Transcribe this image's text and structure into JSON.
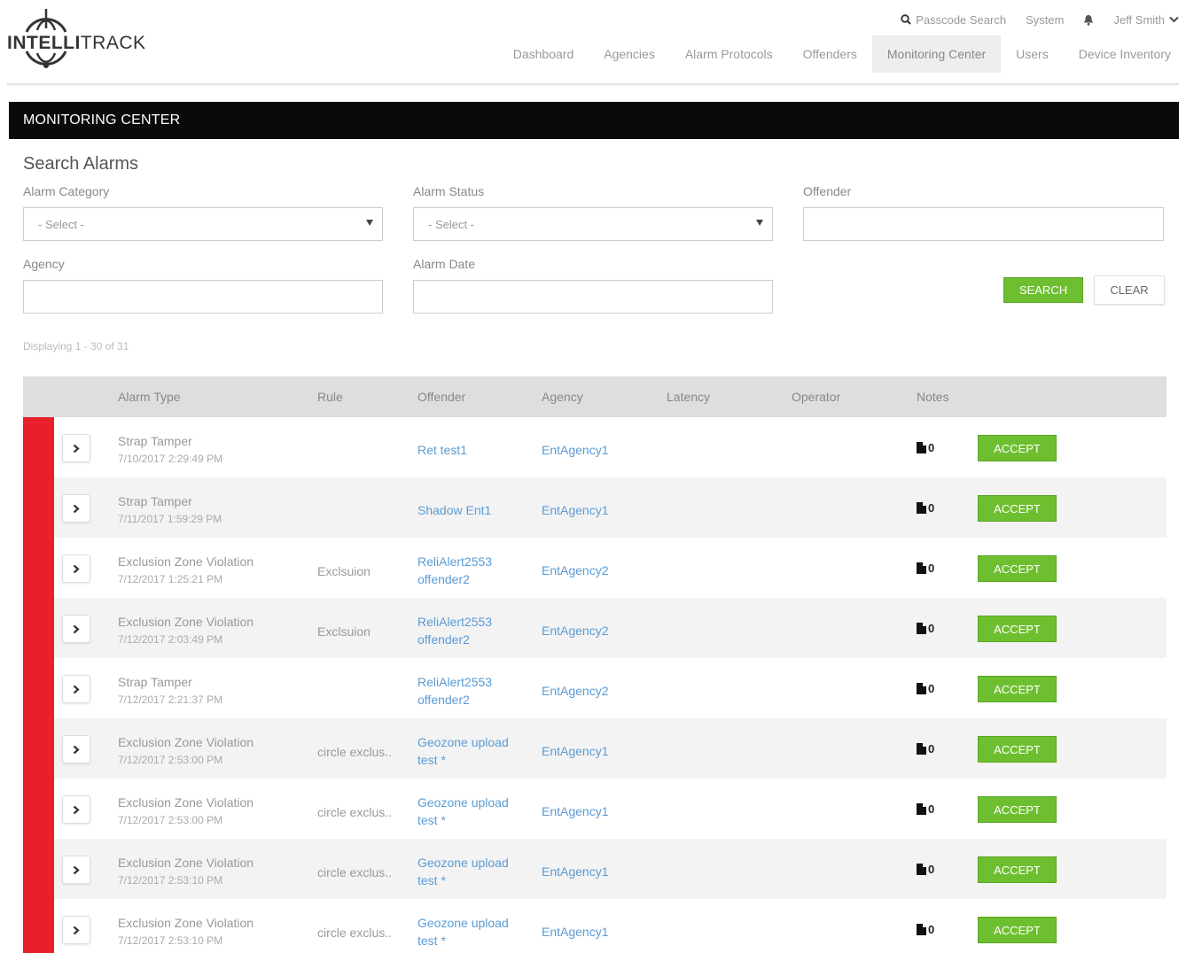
{
  "brand": {
    "logo_bold": "INTELLI",
    "logo_rest": "TRACK"
  },
  "utility": {
    "passcode_search": "Passcode Search",
    "system": "System",
    "user": "Jeff Smith"
  },
  "nav": [
    {
      "label": "Dashboard",
      "active": false
    },
    {
      "label": "Agencies",
      "active": false
    },
    {
      "label": "Alarm Protocols",
      "active": false
    },
    {
      "label": "Offenders",
      "active": false
    },
    {
      "label": "Monitoring Center",
      "active": true
    },
    {
      "label": "Users",
      "active": false
    },
    {
      "label": "Device Inventory",
      "active": false
    }
  ],
  "panel_title": "MONITORING CENTER",
  "search": {
    "title": "Search Alarms",
    "alarm_category_label": "Alarm Category",
    "alarm_category_value": "- Select -",
    "alarm_status_label": "Alarm Status",
    "alarm_status_value": "- Select -",
    "offender_label": "Offender",
    "offender_value": "",
    "agency_label": "Agency",
    "agency_value": "",
    "alarm_date_label": "Alarm Date",
    "alarm_date_value": "",
    "search_button": "SEARCH",
    "clear_button": "CLEAR"
  },
  "count_text": "Displaying 1 - 30 of 31",
  "table": {
    "columns": [
      "Alarm Type",
      "Rule",
      "Offender",
      "Agency",
      "Latency",
      "Operator",
      "Notes"
    ],
    "accept_label": "ACCEPT",
    "rows": [
      {
        "type": "Strap Tamper",
        "time": "7/10/2017 2:29:49 PM",
        "rule": "",
        "offender": [
          "Ret test1"
        ],
        "agency": "EntAgency1",
        "notes": "0"
      },
      {
        "type": "Strap Tamper",
        "time": "7/11/2017 1:59:29 PM",
        "rule": "",
        "offender": [
          "Shadow Ent1"
        ],
        "agency": "EntAgency1",
        "notes": "0"
      },
      {
        "type": "Exclusion Zone Violation",
        "time": "7/12/2017 1:25:21 PM",
        "rule": "Exclsuion",
        "offender": [
          "ReliAlert2553",
          "offender2"
        ],
        "agency": "EntAgency2",
        "notes": "0"
      },
      {
        "type": "Exclusion Zone Violation",
        "time": "7/12/2017 2:03:49 PM",
        "rule": "Exclsuion",
        "offender": [
          "ReliAlert2553",
          "offender2"
        ],
        "agency": "EntAgency2",
        "notes": "0"
      },
      {
        "type": "Strap Tamper",
        "time": "7/12/2017 2:21:37 PM",
        "rule": "",
        "offender": [
          "ReliAlert2553",
          "offender2"
        ],
        "agency": "EntAgency2",
        "notes": "0"
      },
      {
        "type": "Exclusion Zone Violation",
        "time": "7/12/2017 2:53:00 PM",
        "rule": "circle exclus..",
        "offender": [
          "Geozone upload",
          "test *"
        ],
        "agency": "EntAgency1",
        "notes": "0"
      },
      {
        "type": "Exclusion Zone Violation",
        "time": "7/12/2017 2:53:00 PM",
        "rule": "circle exclus..",
        "offender": [
          "Geozone upload",
          "test *"
        ],
        "agency": "EntAgency1",
        "notes": "0"
      },
      {
        "type": "Exclusion Zone Violation",
        "time": "7/12/2017 2:53:10 PM",
        "rule": "circle exclus..",
        "offender": [
          "Geozone upload",
          "test *"
        ],
        "agency": "EntAgency1",
        "notes": "0"
      },
      {
        "type": "Exclusion Zone Violation",
        "time": "7/12/2017 2:53:10 PM",
        "rule": "circle exclus..",
        "offender": [
          "Geozone upload",
          "test *"
        ],
        "agency": "EntAgency1",
        "notes": "0"
      }
    ]
  },
  "colors": {
    "accent_green": "#6ebf2f",
    "alarm_red": "#e8202a",
    "link_blue": "#5b9bd5",
    "panel_black": "#0a0a0a"
  }
}
